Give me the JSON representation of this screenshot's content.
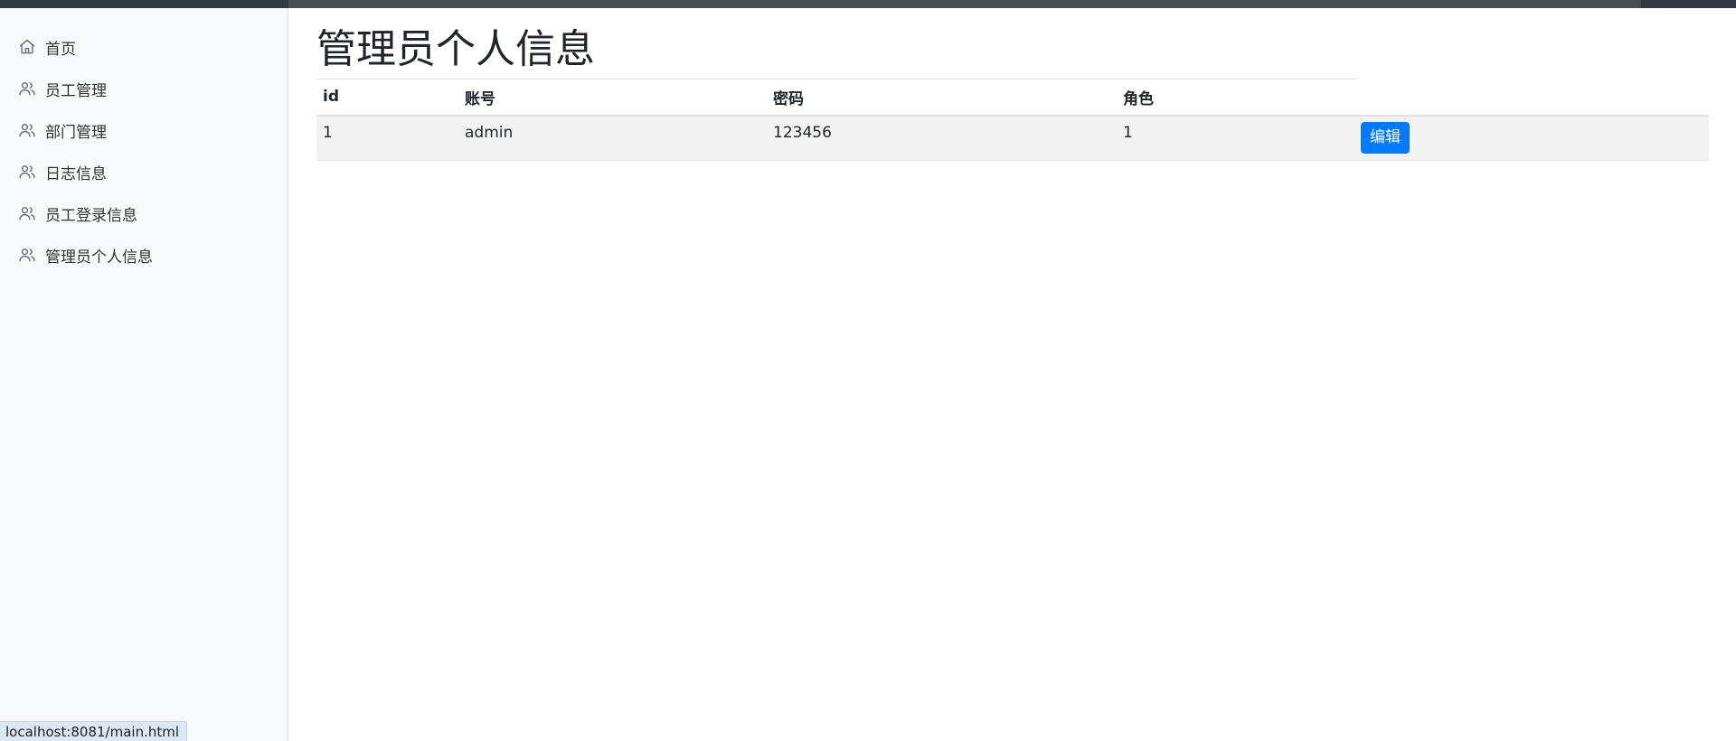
{
  "sidebar": {
    "items": [
      {
        "label": "首页",
        "icon": "home-icon"
      },
      {
        "label": "员工管理",
        "icon": "users-icon"
      },
      {
        "label": "部门管理",
        "icon": "users-icon"
      },
      {
        "label": "日志信息",
        "icon": "users-icon"
      },
      {
        "label": "员工登录信息",
        "icon": "users-icon"
      },
      {
        "label": "管理员个人信息",
        "icon": "users-icon"
      }
    ]
  },
  "main": {
    "title": "管理员个人信息",
    "table": {
      "headers": [
        "id",
        "账号",
        "密码",
        "角色"
      ],
      "rows": [
        {
          "id": "1",
          "account": "admin",
          "password": "123456",
          "role": "1",
          "action_label": "编辑"
        }
      ]
    }
  },
  "status_bar": {
    "url": "localhost:8081/main.html"
  },
  "colors": {
    "accent": "#007bff",
    "topbar": "#343a40",
    "sidebar_bg": "#f8f9fa"
  }
}
